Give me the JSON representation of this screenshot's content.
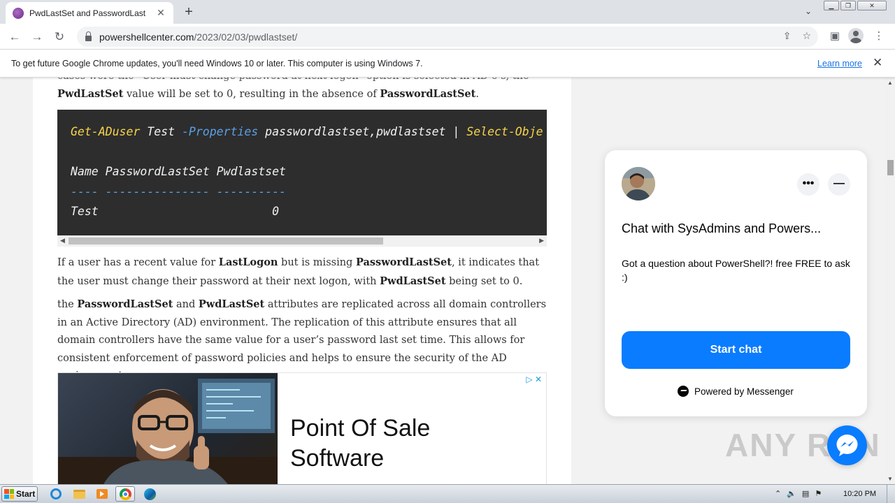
{
  "browser": {
    "tab_title": "PwdLastSet and PasswordLastSet",
    "url_host": "powershellcenter.com",
    "url_path": "/2023/02/03/pwdlastset/"
  },
  "infobar": {
    "message": "To get future Google Chrome updates, you'll need Windows 10 or later. This computer is using Windows 7.",
    "link": "Learn more"
  },
  "article": {
    "cut_line": "cases were the \"User must change password at next logon\" option is selected in AD o s, the",
    "para1": {
      "term1": "PwdLastSet",
      "text1": " value will be set to 0, resulting in the absence of ",
      "term2": "PasswordLastSet",
      "text2": "."
    },
    "code": {
      "cmd": "Get-ADuser",
      "arg1": " Test ",
      "param": "-Properties",
      "arg2": " passwordlastset,pwdlastset ",
      "pipe": "| ",
      "cmd2": "Select-Obje",
      "header": "Name PasswordLastSet Pwdlastset",
      "underline": "---- --------------- ----------",
      "row": "Test                         0"
    },
    "para2": {
      "text1": "If a user has a recent value for ",
      "term1": "LastLogon",
      "text2": " but is missing ",
      "term2": "PasswordLastSet",
      "text3": ", it indicates that the user must change their password at their next logon, with ",
      "term3": "PwdLastSet",
      "text4": " being set to 0."
    },
    "para3": {
      "text1": "the ",
      "term1": "PasswordLastSet",
      "text2": " and ",
      "term2": "PwdLastSet",
      "text3": " attributes are replicated across all domain controllers in an Active Directory (AD) environment. The replication of this attribute ensures that all domain controllers have the same value for a user’s password last set time. This allows for consistent enforcement of password policies and helps to ensure the security of the AD environment."
    },
    "ad": {
      "headline_line1": "Point Of Sale",
      "headline_line2": "Software"
    }
  },
  "chat": {
    "title": "Chat with SysAdmins and Powers...",
    "description": "Got a question about PowerShell?! free FREE to ask :)",
    "button": "Start chat",
    "powered_by": "Powered by Messenger"
  },
  "watermark": "ANY RUN",
  "taskbar": {
    "start_label": "Start",
    "clock": "10:20 PM"
  },
  "colors": {
    "messenger_blue": "#0a7cff",
    "code_bg": "#2d2d2d",
    "code_keyword": "#f7d44a",
    "link_blue": "#1a73e8"
  }
}
